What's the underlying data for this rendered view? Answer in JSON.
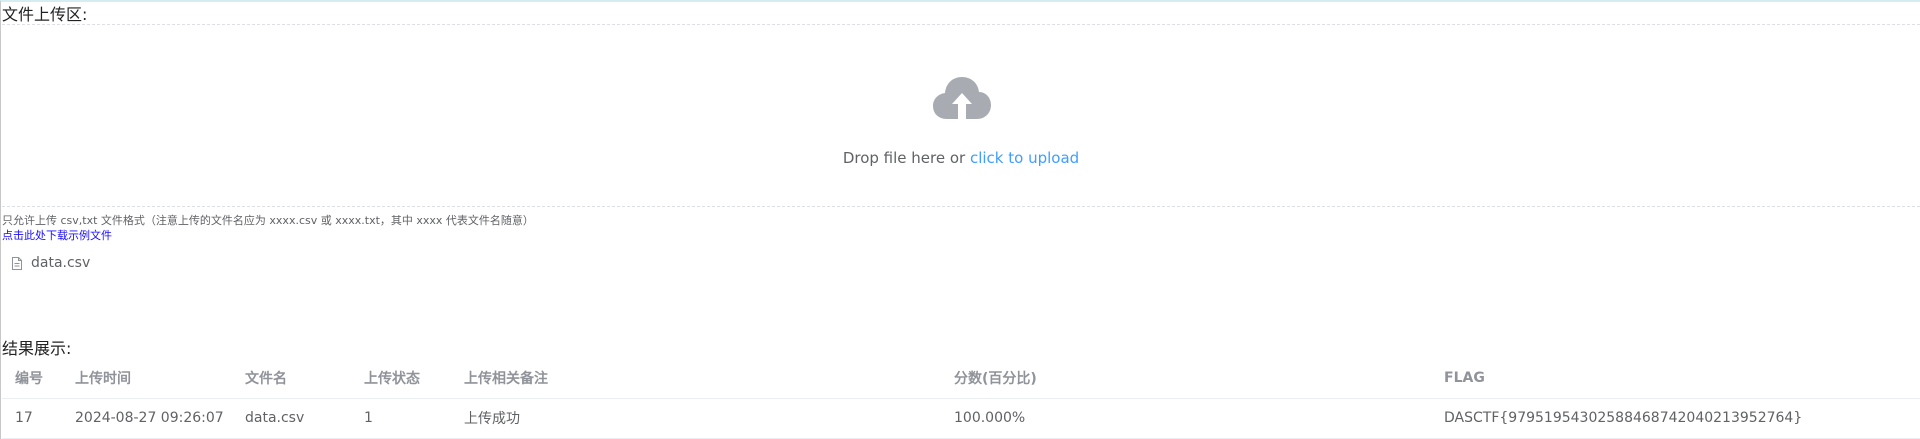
{
  "upload_section": {
    "title": "文件上传区:",
    "drop_text": "Drop file here or ",
    "drop_link": "click to upload",
    "tip": "只允许上传 csv,txt 文件格式（注意上传的文件名应为 xxxx.csv 或 xxxx.txt，其中 xxxx 代表文件名随意）",
    "download_link": "点击此处下载示例文件",
    "icon": "upload-cloud-icon",
    "uploaded_files": [
      {
        "name": "data.csv",
        "icon": "document-icon"
      }
    ]
  },
  "results_section": {
    "title": "结果展示:",
    "columns": [
      "编号",
      "上传时间",
      "文件名",
      "上传状态",
      "上传相关备注",
      "分数(百分比)",
      "FLAG"
    ],
    "rows": [
      {
        "id": "17",
        "time": "2024-08-27 09:26:07",
        "filename": "data.csv",
        "status": "1",
        "note": "上传成功",
        "score": "100.000%",
        "flag": "DASCTF{97951954302588468742040213952764}"
      }
    ]
  },
  "colors": {
    "link": "#409eff",
    "download_link": "#1a0dff",
    "icon": "#a8abb2",
    "header_text": "#909399"
  }
}
